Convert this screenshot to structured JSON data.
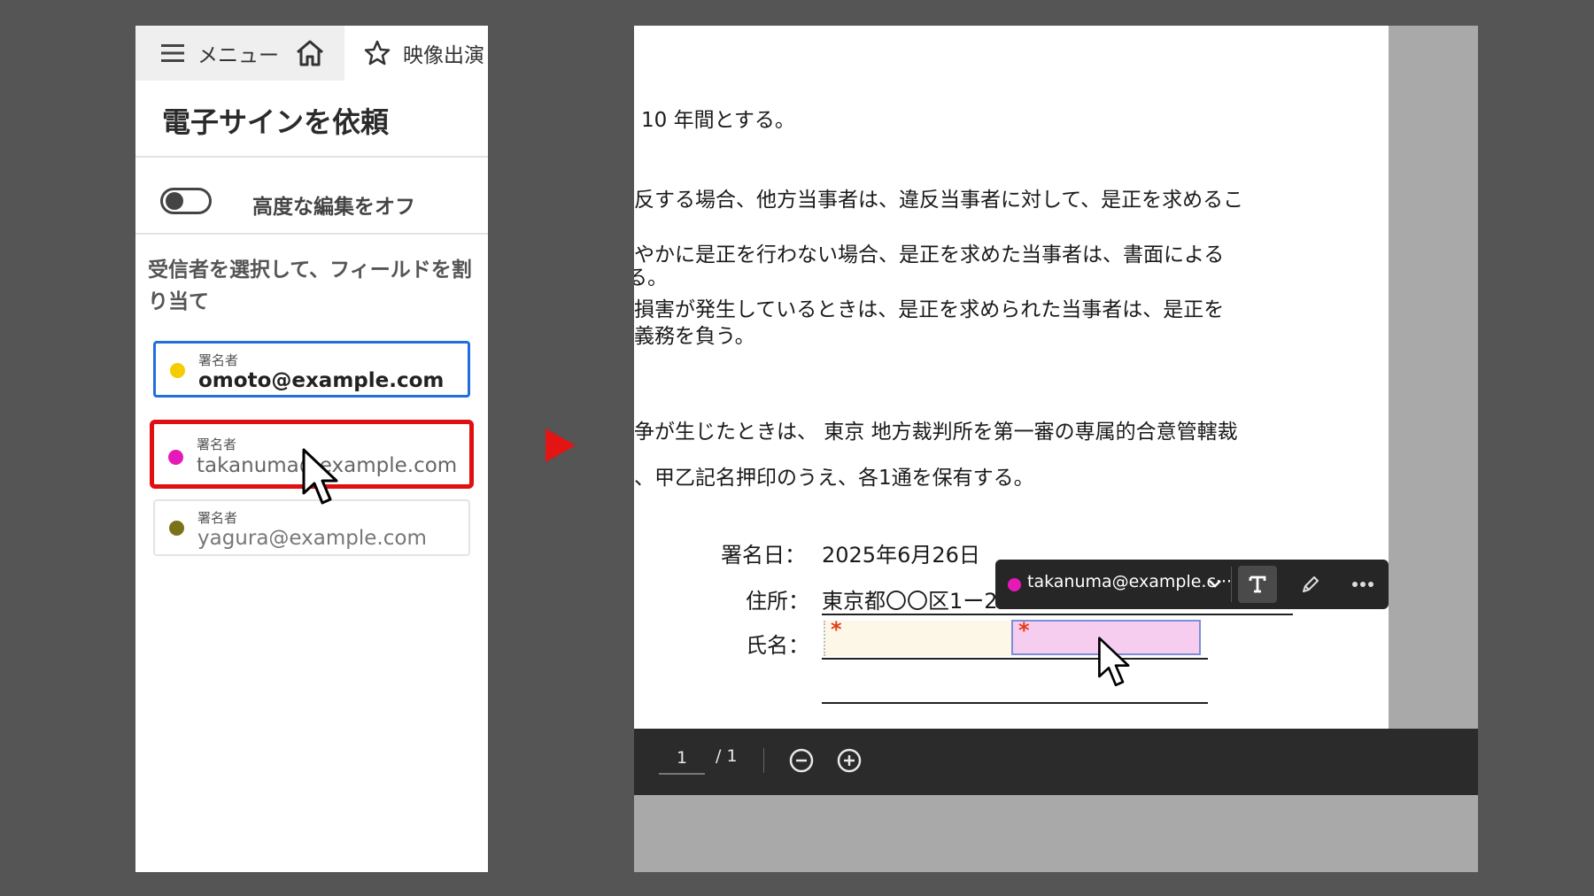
{
  "left_panel": {
    "topbar": {
      "menu_label": "メニュー",
      "tab_label": "映像出演"
    },
    "title": "電子サインを依頼",
    "toggle_label": "高度な編集をオフ",
    "instruction": "受信者を選択して、フィールドを割り当て",
    "recipients": [
      {
        "role": "署名者",
        "email": "omoto@example.com",
        "color": "#f5cc00"
      },
      {
        "role": "署名者",
        "email": "takanuma@example.com",
        "color": "#e619b8"
      },
      {
        "role": "署名者",
        "email": "yagura@example.com",
        "color": "#7a7218"
      }
    ]
  },
  "document": {
    "lines": [
      "10 年間とする。",
      "反する場合、他方当事者は、違反当事者に対して、是正を求めるこ",
      "やかに是正を行わない場合、是正を求めた当事者は、書面による",
      "る。",
      "損害が発生しているときは、是正を求められた当事者は、是正を",
      "義務を負う。",
      "争が生じたときは、 東京 地方裁判所を第一審の専属的合意管轄裁",
      "、甲乙記名押印のうえ、各1通を保有する。"
    ],
    "sign_date_label": "署名日：",
    "sign_date_value": "2025年6月26日",
    "address_label": "住所：",
    "address_value": "東京都〇〇区1ー2",
    "name_label": "氏名：",
    "required_mark": "*"
  },
  "field_toolbar": {
    "recipient_email": "takanuma@example.c···",
    "recipient_color": "#e619b8",
    "text_icon": "text-tool-icon",
    "pen_icon": "pen-icon",
    "more_icon": "more-icon"
  },
  "pager": {
    "current_page": "1",
    "total": "/ 1"
  },
  "colors": {
    "background": "#555555",
    "highlight": "#e01010",
    "selected_border": "#1f6fdd"
  }
}
